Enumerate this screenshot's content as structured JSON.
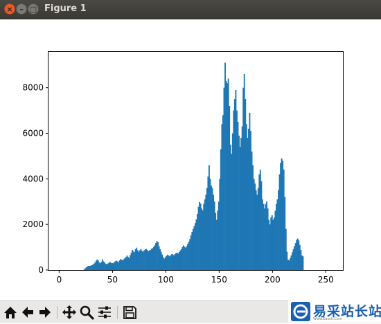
{
  "window": {
    "title": "Figure 1",
    "close_glyph": "×",
    "minimize_glyph": "–",
    "maximize_glyph": "□"
  },
  "toolbar": {
    "buttons": [
      {
        "name": "home",
        "icon": "home-icon"
      },
      {
        "name": "back",
        "icon": "arrow-left-icon"
      },
      {
        "name": "forward",
        "icon": "arrow-right-icon"
      },
      {
        "name": "pan",
        "icon": "move-arrows-icon"
      },
      {
        "name": "zoom",
        "icon": "magnifier-icon"
      },
      {
        "name": "configure-subplots",
        "icon": "sliders-icon"
      },
      {
        "name": "save",
        "icon": "floppy-disk-icon"
      }
    ]
  },
  "watermark": {
    "text": "易采站长站",
    "subtext": "Www.Easck.Com"
  },
  "colors": {
    "bar": "#1f77b4",
    "titlebar": "#3c3b37",
    "toolbar": "#e9e8e6"
  },
  "chart_data": {
    "type": "bar",
    "title": "",
    "xlabel": "",
    "ylabel": "",
    "xlim": [
      -10,
      266
    ],
    "ylim": [
      0,
      9570
    ],
    "xticks": [
      0,
      50,
      100,
      150,
      200,
      250
    ],
    "yticks": [
      0,
      2000,
      4000,
      6000,
      8000
    ],
    "grid": false,
    "bin_start": 0,
    "bin_width": 1,
    "values": [
      0,
      0,
      0,
      0,
      0,
      0,
      0,
      0,
      0,
      0,
      0,
      0,
      0,
      0,
      0,
      0,
      0,
      0,
      0,
      0,
      0,
      0,
      0,
      40,
      80,
      120,
      160,
      180,
      180,
      190,
      210,
      230,
      270,
      320,
      400,
      460,
      420,
      330,
      300,
      360,
      470,
      380,
      330,
      280,
      250,
      280,
      310,
      350,
      320,
      300,
      300,
      340,
      380,
      410,
      380,
      340,
      420,
      480,
      450,
      430,
      470,
      520,
      560,
      630,
      580,
      520,
      650,
      760,
      880,
      820,
      780,
      920,
      980,
      870,
      800,
      860,
      920,
      850,
      800,
      860,
      900,
      920,
      880,
      820,
      860,
      880,
      930,
      960,
      1010,
      1080,
      1180,
      1270,
      1220,
      1050,
      920,
      800,
      680,
      560,
      500,
      560,
      620,
      670,
      640,
      600,
      650,
      700,
      680,
      640,
      700,
      740,
      760,
      720,
      790,
      860,
      920,
      1010,
      1080,
      1020,
      980,
      1050,
      1150,
      1240,
      1360,
      1520,
      1670,
      1800,
      1920,
      2060,
      2220,
      2460,
      2780,
      2980,
      2920,
      2700,
      2620,
      2900,
      3100,
      3300,
      3600,
      4100,
      4600,
      4000,
      3700,
      3600,
      3300,
      3000,
      2500,
      2200,
      2600,
      3000,
      4000,
      5300,
      6400,
      6800,
      8000,
      9100,
      8300,
      8200,
      8400,
      7200,
      5500,
      5100,
      6000,
      7000,
      7500,
      7900,
      7000,
      6500,
      5900,
      5400,
      5800,
      6300,
      8000,
      8600,
      7500,
      6400,
      5800,
      6200,
      6900,
      6100,
      5200,
      4600,
      4000,
      3800,
      3500,
      3300,
      3600,
      4200,
      4400,
      3900,
      3100,
      2900,
      2700,
      2900,
      3000,
      2700,
      2200,
      2000,
      2300,
      2400,
      2200,
      2300,
      2600,
      2900,
      3100,
      3500,
      4200,
      4700,
      4900,
      4800,
      4400,
      3200,
      1800,
      800,
      450,
      420,
      520,
      640,
      780,
      920,
      1050,
      1180,
      1320,
      1380,
      1300,
      1100,
      880,
      640,
      600,
      0,
      0,
      0,
      0,
      0,
      0,
      0,
      0,
      0,
      0
    ]
  }
}
